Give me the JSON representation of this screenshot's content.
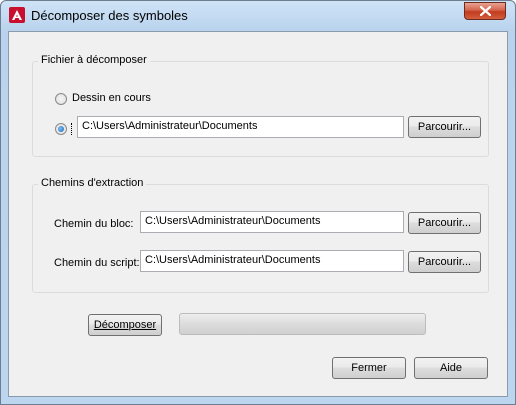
{
  "window": {
    "title": "Décomposer des symboles"
  },
  "file_group": {
    "title": "Fichier à décomposer",
    "option_current_drawing": {
      "label": "Dessin en cours",
      "selected": false
    },
    "option_path": {
      "value": "C:\\Users\\Administrateur\\Documents",
      "selected": true
    },
    "browse_label": "Parcourir..."
  },
  "extract_group": {
    "title": "Chemins d'extraction",
    "block_path": {
      "label": "Chemin du bloc:",
      "value": "C:\\Users\\Administrateur\\Documents",
      "browse_label": "Parcourir..."
    },
    "script_path": {
      "label": "Chemin du script:",
      "value": "C:\\Users\\Administrateur\\Documents",
      "browse_label": "Parcourir..."
    }
  },
  "actions": {
    "decompose_label": "Décomposer",
    "close_label": "Fermer",
    "help_label": "Aide"
  },
  "progress": {
    "value": 0
  }
}
